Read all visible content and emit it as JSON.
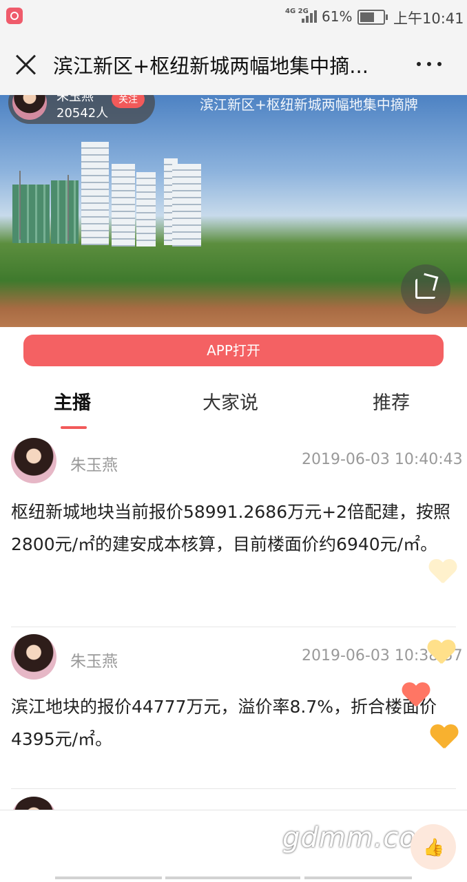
{
  "status_bar": {
    "network": "4G 2G",
    "battery": "61%",
    "time": "上午10:41"
  },
  "header": {
    "title": "滨江新区+枢纽新城两幅地集中摘...",
    "close_icon": "close-icon",
    "more_icon": "more-icon"
  },
  "hero": {
    "host_name": "朱玉燕",
    "host_count": "20542人",
    "follow_label": "关注",
    "caption": "滨江新区+枢纽新城两幅地集中摘牌"
  },
  "app_button": "APP打开",
  "tabs": [
    "主播",
    "大家说",
    "推荐"
  ],
  "posts": [
    {
      "author": "朱玉燕",
      "time": "2019-06-03 10:40:43",
      "content": "枢纽新城地块当前报价58991.2686万元+2倍配建，按照2800元/㎡的建安成本核算，目前楼面价约6940元/㎡。"
    },
    {
      "author": "朱玉燕",
      "time": "2019-06-03 10:38:57",
      "content": "滨江地块的报价44777万元，溢价率8.7%，折合楼面价4395元/㎡。"
    }
  ],
  "bottom": {
    "watermark": "gdmm.com",
    "like_icon": "👍"
  },
  "colors": {
    "accent": "#f46163",
    "tab_underline": "#f25a5a"
  }
}
